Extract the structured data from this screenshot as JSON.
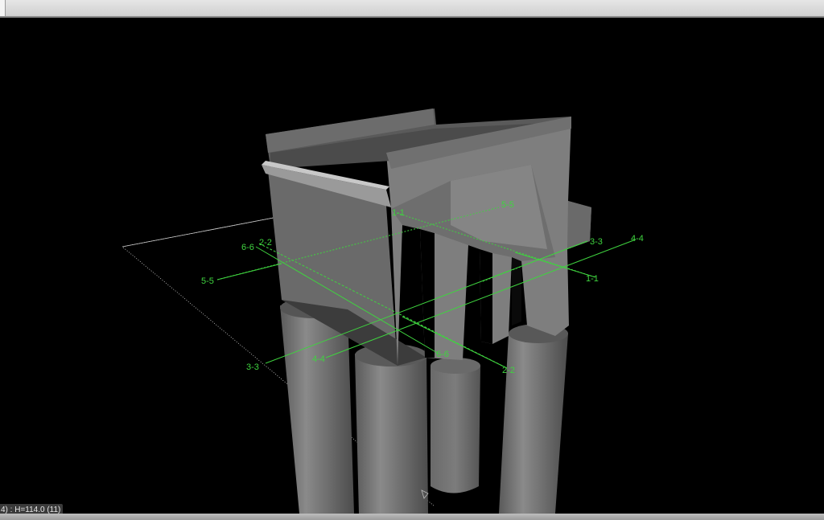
{
  "window": {
    "title": ""
  },
  "viewport": {
    "background": "#000000",
    "model": "pier cap on four cylindrical columns",
    "colors": {
      "section_line": "#3fd33f",
      "ground_outline": "#cfcfcf",
      "concrete_light": "#7a7a7a",
      "concrete_mid": "#606060",
      "concrete_dark": "#4a4a4a"
    }
  },
  "sections": {
    "s11": [
      "1-1",
      "1-1"
    ],
    "s22": [
      "2-2",
      "2-2"
    ],
    "s33": [
      "3-3",
      "3-3"
    ],
    "s44": [
      "4-4",
      "4-4"
    ],
    "s55": [
      "5-5",
      "5-5"
    ],
    "s66": [
      "6-6",
      "6-6"
    ]
  },
  "status": {
    "readout": "4) : H=114.0 (11)"
  }
}
